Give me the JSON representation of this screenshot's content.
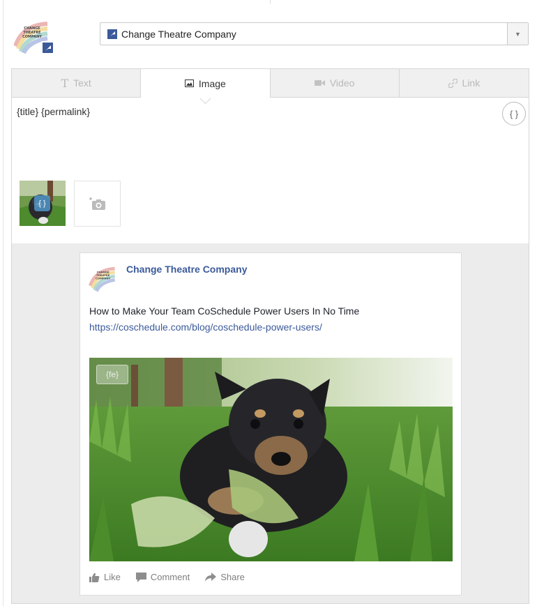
{
  "account": {
    "name": "Change Theatre Company",
    "logo_text": "CHANGE THEATRE COMPANY"
  },
  "tabs": [
    {
      "label": "Text",
      "icon": "text-icon",
      "active": false
    },
    {
      "label": "Image",
      "icon": "image-icon",
      "active": true
    },
    {
      "label": "Video",
      "icon": "video-icon",
      "active": false
    },
    {
      "label": "Link",
      "icon": "link-icon",
      "active": false
    }
  ],
  "composer": {
    "message": "{title} {permalink}",
    "token_button": "{ }",
    "thumb_token": "{ }"
  },
  "preview": {
    "page_name": "Change Theatre Company",
    "post_title": "How to Make Your Team CoSchedule Power Users In No Time",
    "post_link": "https://coschedule.com/blog/coschedule-power-users/",
    "image_token": "{fe}",
    "actions": [
      "Like",
      "Comment",
      "Share"
    ]
  },
  "colors": {
    "facebook_blue": "#3b5a9a",
    "border": "#d6d6d6",
    "preview_bg": "#ececec"
  }
}
